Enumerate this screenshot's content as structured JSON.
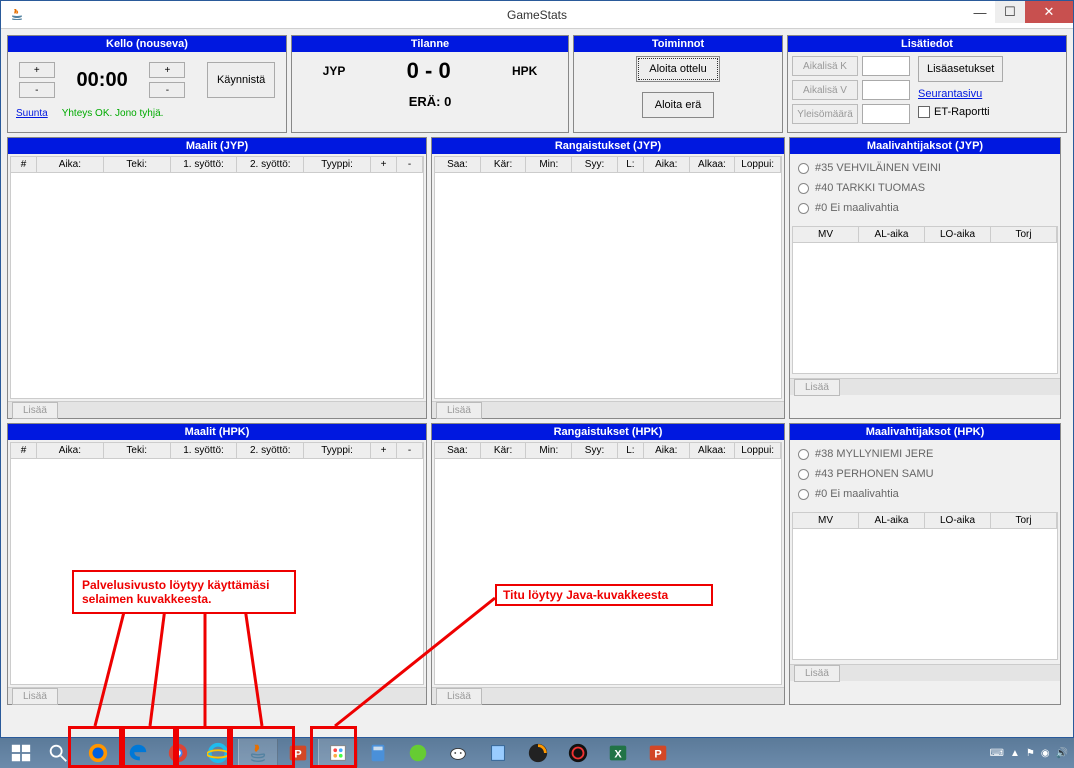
{
  "window": {
    "title": "GameStats"
  },
  "kello": {
    "header": "Kello (nouseva)",
    "time": "00:00",
    "start": "Käynnistä",
    "direction_link": "Suunta",
    "status": "Yhteys OK. Jono tyhjä.",
    "plus": "+",
    "minus": "-"
  },
  "tilanne": {
    "header": "Tilanne",
    "home": "JYP",
    "score": "0 - 0",
    "away": "HPK",
    "period": "ERÄ: 0"
  },
  "toiminnot": {
    "header": "Toiminnot",
    "start_match": "Aloita ottelu",
    "start_period": "Aloita erä"
  },
  "lisatiedot": {
    "header": "Lisätiedot",
    "aikalisa_k": "Aikalisä K",
    "aikalisa_v": "Aikalisä V",
    "yleiso": "Yleisömäärä",
    "lisaasetukset": "Lisäasetukset",
    "seurantasivu": "Seurantasivu",
    "et_raportti": "ET-Raportti"
  },
  "maalit_jyp": {
    "header": "Maalit (JYP)",
    "cols": {
      "c0": "#",
      "c1": "Aika:",
      "c2": "Teki:",
      "c3": "1. syöttö:",
      "c4": "2. syöttö:",
      "c5": "Tyyppi:",
      "c6": "+",
      "c7": "-"
    },
    "add": "Lisää"
  },
  "rang_jyp": {
    "header": "Rangaistukset (JYP)",
    "cols": {
      "c0": "Saa:",
      "c1": "Kär:",
      "c2": "Min:",
      "c3": "Syy:",
      "c4": "L:",
      "c5": "Aika:",
      "c6": "Alkaa:",
      "c7": "Loppui:"
    },
    "add": "Lisää"
  },
  "mvj_jyp": {
    "header": "Maalivahtijaksot (JYP)",
    "goalies": {
      "g0": "#35 VEHVILÄINEN VEINI",
      "g1": "#40 TARKKI TUOMAS",
      "g2": "#0 Ei maalivahtia"
    },
    "cols": {
      "c0": "MV",
      "c1": "AL-aika",
      "c2": "LO-aika",
      "c3": "Torj"
    },
    "add": "Lisää"
  },
  "maalit_hpk": {
    "header": "Maalit (HPK)",
    "cols": {
      "c0": "#",
      "c1": "Aika:",
      "c2": "Teki:",
      "c3": "1. syöttö:",
      "c4": "2. syöttö:",
      "c5": "Tyyppi:",
      "c6": "+",
      "c7": "-"
    },
    "add": "Lisää"
  },
  "rang_hpk": {
    "header": "Rangaistukset (HPK)",
    "cols": {
      "c0": "Saa:",
      "c1": "Kär:",
      "c2": "Min:",
      "c3": "Syy:",
      "c4": "L:",
      "c5": "Aika:",
      "c6": "Alkaa:",
      "c7": "Loppui:"
    },
    "add": "Lisää"
  },
  "mvj_hpk": {
    "header": "Maalivahtijaksot (HPK)",
    "goalies": {
      "g0": "#38 MYLLYNIEMI JERE",
      "g1": "#43 PERHONEN SAMU",
      "g2": "#0 Ei maalivahtia"
    },
    "cols": {
      "c0": "MV",
      "c1": "AL-aika",
      "c2": "LO-aika",
      "c3": "Torj"
    },
    "add": "Lisää"
  },
  "annotations": {
    "browser_note": "Palvelusivusto löytyy käyttämäsi selaimen kuvakkeesta.",
    "java_note": "Titu löytyy Java-kuvakkeesta"
  }
}
